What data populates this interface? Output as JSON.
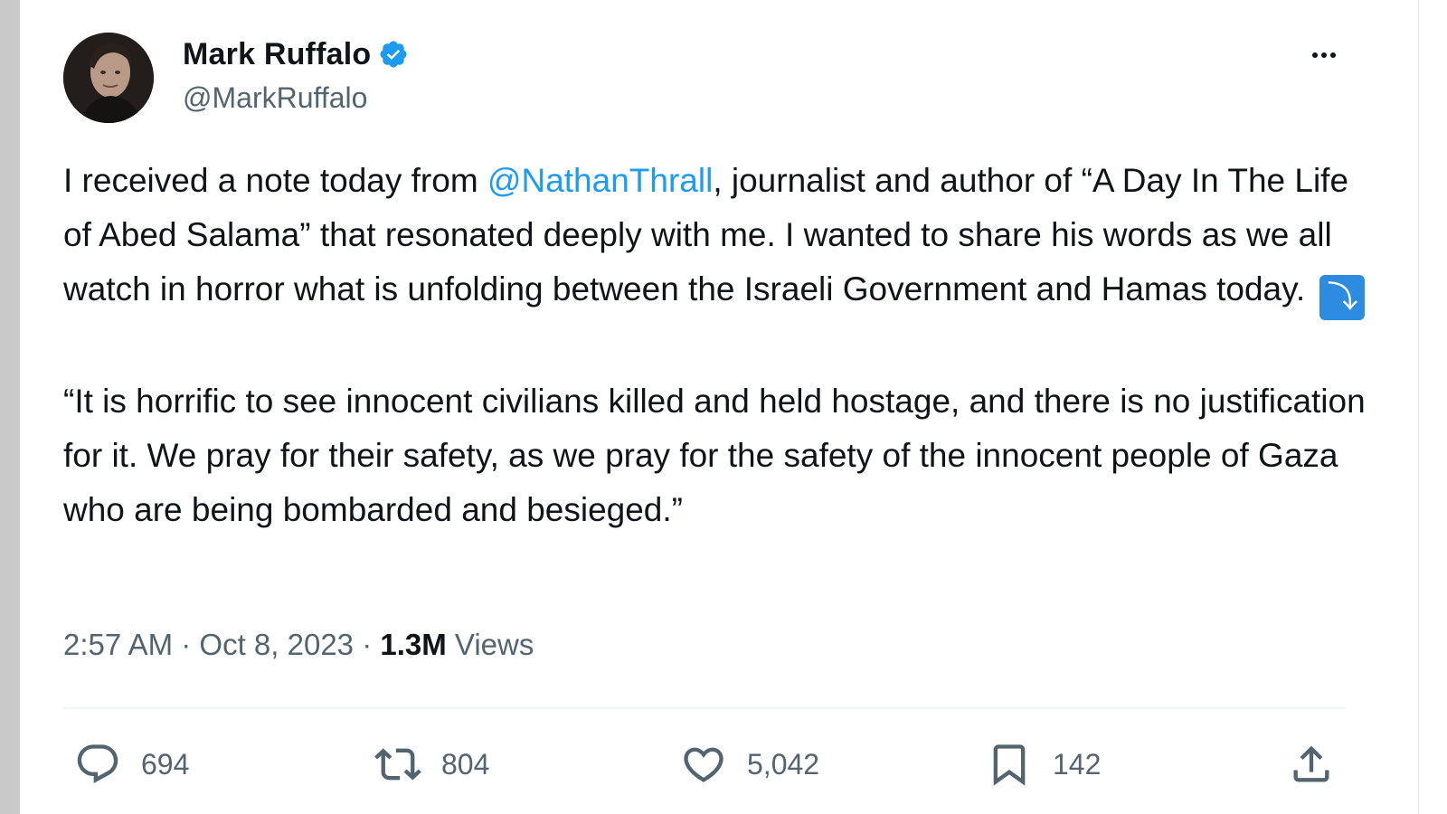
{
  "author": {
    "display_name": "Mark Ruffalo",
    "handle": "@MarkRuffalo",
    "verified": true
  },
  "tweet": {
    "paragraph1": {
      "before_mention": "I received a note today from ",
      "mention": "@NathanThrall",
      "after_mention": ", journalist and author of “A Day In The Life of Abed Salama” that resonated deeply with me. I wanted to share his words as we all watch in horror what is unfolding between the Israeli Government and Hamas today.",
      "emoji": "⤵"
    },
    "paragraph2": "“It is horrific to see innocent civilians killed and held hostage, and there is no justification for it. We pray for their safety, as we pray for the safety of the innocent people of Gaza who are being bombarded and besieged.”"
  },
  "meta": {
    "time": "2:57 AM",
    "separator": "·",
    "date": "Oct 8, 2023",
    "views_count": "1.3M",
    "views_label": "Views"
  },
  "actions": {
    "replies": "694",
    "reposts": "804",
    "likes": "5,042",
    "bookmarks": "142"
  },
  "colors": {
    "accent": "#1d9bf0",
    "text": "#0f1419",
    "muted": "#536471",
    "divider": "#eff3f4"
  },
  "icons": [
    "verified-badge-icon",
    "more-icon",
    "reply-icon",
    "repost-icon",
    "like-icon",
    "bookmark-icon",
    "share-icon"
  ]
}
